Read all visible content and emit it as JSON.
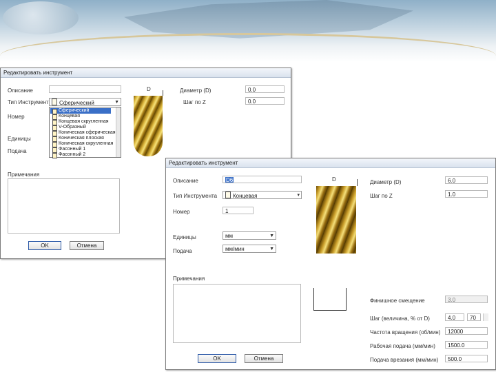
{
  "dialog1": {
    "title": "Редактировать инструмент",
    "label_description": "Описание",
    "label_tool_type": "Тип Инструмента",
    "tool_type_value": "Сферический",
    "label_number": "Номер",
    "label_units": "Единицы",
    "label_feed": "Подача",
    "label_notes": "Примечания",
    "diam_symbol": "D",
    "label_diameter": "Диаметр (D)",
    "diameter_value": "0.0",
    "label_step_z": "Шаг по Z",
    "step_z_value": "0.0",
    "ok_label": "OK",
    "cancel_label": "Отмена",
    "dropdown_items": [
      "Сферический",
      "Концевая",
      "Концевая скругленная",
      "V-Образный",
      "Коническая сферическая",
      "Коническая плоская",
      "Коническая скругленная",
      "Фасонный 1",
      "Фасонный 2"
    ]
  },
  "dialog2": {
    "title": "Редактировать инструмент",
    "label_description": "Описание",
    "description_value": "D6",
    "label_tool_type": "Тип Инструмента",
    "tool_type_value": "Концевая",
    "label_number": "Номер",
    "number_value": "1",
    "label_units": "Единицы",
    "units_value": "мм",
    "label_feed": "Подача",
    "feed_value": "мм/мин",
    "label_notes": "Примечания",
    "diam_symbol": "D",
    "label_diameter": "Диаметр (D)",
    "diameter_value": "6.0",
    "label_step_z": "Шаг по Z",
    "step_z_value": "1.0",
    "label_finish_offset": "Финишное смещение",
    "finish_offset_value": "3.0",
    "label_stepover": "Шаг (величина, % от D)",
    "stepover_value": "4.0",
    "stepover_percent": "70",
    "label_spindle_speed": "Частота вращения (об/мин)",
    "spindle_speed_value": "12000",
    "label_feed_rate": "Рабочая подача (мм/мин)",
    "feed_rate_value": "1500.0",
    "label_plunge_rate": "Подача врезания (мм/мин)",
    "plunge_rate_value": "500.0",
    "ok_label": "OK",
    "cancel_label": "Отмена"
  },
  "colors": {
    "title_gradient_top": "#f3f6fa",
    "title_gradient_bottom": "#d9e2ee",
    "selection": "#3a6fc7",
    "tool_gold": "#d9b23a"
  }
}
